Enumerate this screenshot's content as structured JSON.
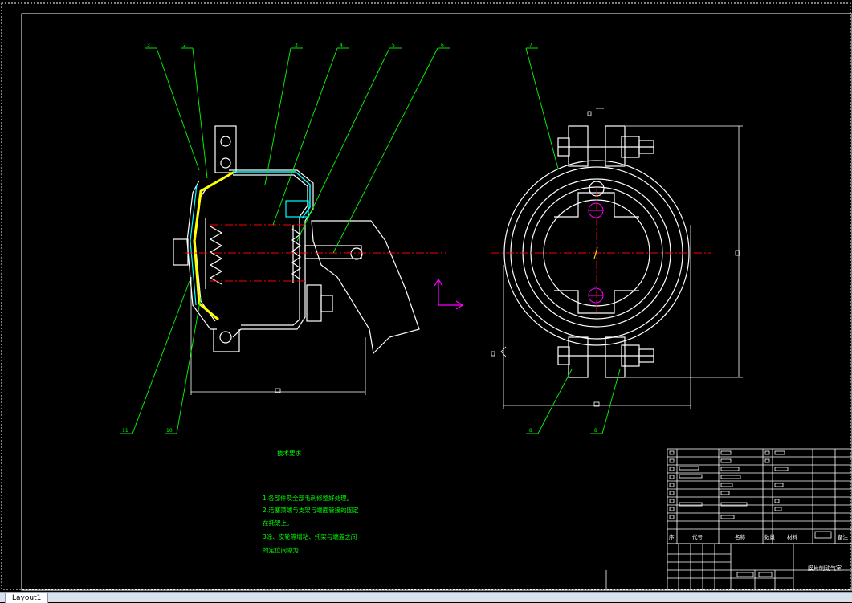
{
  "drawing": {
    "balloons_left": [
      "3",
      "2",
      "3",
      "4",
      "5",
      "6",
      "11",
      "10"
    ],
    "balloons_right": [
      "7",
      "8",
      "8"
    ],
    "technical_requirements_title": "技术要求",
    "technical_requirements": [
      "1.各部件及全部毛刺修整好处理。",
      "2.活塞顶端与支架与端面管接的固定",
      "在托架上。",
      "3涂、皮轮等增粘、托架与端盖之间",
      "的定位间隙为"
    ],
    "title_block": {
      "header_cells": [
        "序",
        "代号",
        "名称",
        "数量",
        "材料",
        "备注"
      ],
      "drawing_name": "膜片制动气室"
    }
  },
  "colors": {
    "background": "#000000",
    "outline": "#ffffff",
    "leader_lines": "#00ff00",
    "center_lines": "#ff0000",
    "diaphragm": "#ffff00",
    "section_hatch": "#00ffff",
    "ucs_icon": "#ff00ff"
  },
  "tabs": {
    "active": "Layout1"
  }
}
